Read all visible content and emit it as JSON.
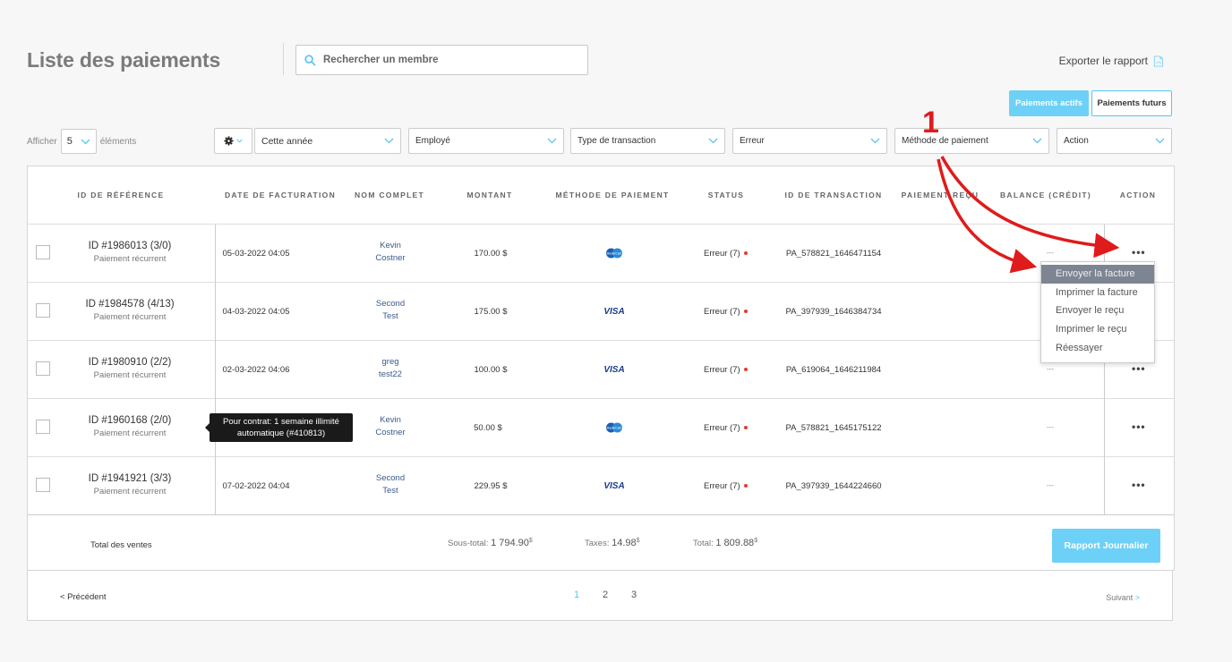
{
  "header": {
    "title": "Liste des paiements",
    "search_placeholder": "Rechercher un membre",
    "export_label": "Exporter le rapport"
  },
  "tabs": {
    "active": "Paiements actifs",
    "future": "Paiements futurs"
  },
  "display": {
    "prefix": "Afficher",
    "count": "5",
    "suffix": "éléments"
  },
  "filters": {
    "period": "Cette année",
    "employee": "Employé",
    "transaction_type": "Type de transaction",
    "error": "Erreur",
    "payment_method": "Méthode de paiement",
    "action": "Action"
  },
  "columns": {
    "ref": "ID DE RÉFÉRENCE",
    "date": "DATE DE FACTURATION",
    "name": "NOM COMPLET",
    "amount": "MONTANT",
    "method": "MÉTHODE DE PAIEMENT",
    "status": "STATUS",
    "txn": "ID DE TRANSACTION",
    "paid": "PAIEMENT REÇU",
    "balance": "BALANCE (CRÉDIT)",
    "action": "ACTION"
  },
  "rows": [
    {
      "ref": "ID #1986013 (3/0)",
      "type": "Paiement récurrent",
      "date": "05-03-2022 04:05",
      "first": "Kevin",
      "last": "Costner",
      "amount": "170.00 $",
      "method": "mastercard",
      "status": "Erreur (7)",
      "txn": "PA_578821_1646471154",
      "balance": "---",
      "action": "•••"
    },
    {
      "ref": "ID #1984578 (4/13)",
      "type": "Paiement récurrent",
      "date": "04-03-2022 04:05",
      "first": "Second",
      "last": "Test",
      "amount": "175.00 $",
      "method": "VISA",
      "status": "Erreur (7)",
      "txn": "PA_397939_1646384734",
      "balance": "---",
      "action": "•••"
    },
    {
      "ref": "ID #1980910 (2/2)",
      "type": "Paiement récurrent",
      "date": "02-03-2022 04:06",
      "first": "greg",
      "last": "test22",
      "amount": "100.00 $",
      "method": "VISA",
      "status": "Erreur (7)",
      "txn": "PA_619064_1646211984",
      "balance": "---",
      "action": "•••"
    },
    {
      "ref": "ID #1960168 (2/0)",
      "type": "Paiement récurrent",
      "date": "",
      "first": "Kevin",
      "last": "Costner",
      "amount": "50.00 $",
      "method": "mastercard",
      "status": "Erreur (7)",
      "txn": "PA_578821_1645175122",
      "balance": "---",
      "action": "•••"
    },
    {
      "ref": "ID #1941921 (3/3)",
      "type": "Paiement récurrent",
      "date": "07-02-2022 04:04",
      "first": "Second",
      "last": "Test",
      "amount": "229.95 $",
      "method": "VISA",
      "status": "Erreur (7)",
      "txn": "PA_397939_1644224660",
      "balance": "---",
      "action": "•••"
    }
  ],
  "totals": {
    "label": "Total des ventes",
    "subtotal_label": "Sous-total:",
    "subtotal": "1 794.90",
    "taxes_label": "Taxes:",
    "taxes": "14.98",
    "total_label": "Total:",
    "total": "1 809.88",
    "currency": "$",
    "report_button": "Rapport Journalier"
  },
  "pagination": {
    "prev": "< Précédent",
    "pages": [
      "1",
      "2",
      "3"
    ],
    "active_page": "1",
    "next": "Suivant",
    "next_arrow": ">"
  },
  "tooltip": {
    "line1": "Pour contrat: 1 semaine illimité",
    "line2": "automatique (#410813)"
  },
  "action_menu": [
    "Envoyer la facture",
    "Imprimer la facture",
    "Envoyer le reçu",
    "Imprimer le reçu",
    "Réessayer"
  ],
  "annotation": {
    "number": "1",
    "color": "#e01b1b"
  },
  "colors": {
    "accent": "#6dd0f7",
    "error_dot": "#e53935",
    "link": "#3a5a8c"
  }
}
